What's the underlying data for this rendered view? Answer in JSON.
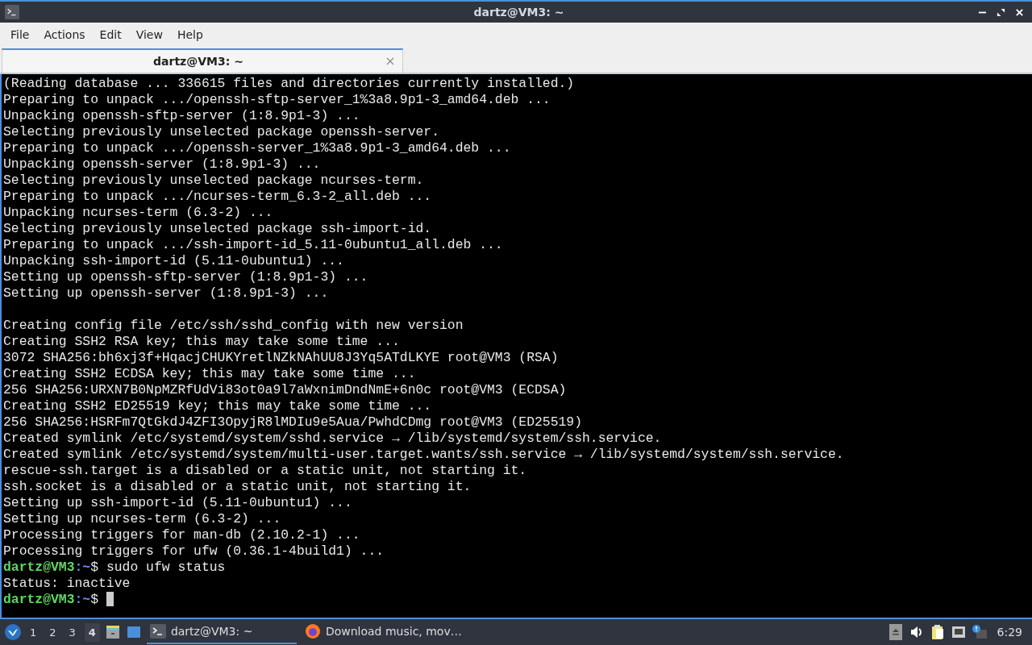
{
  "window": {
    "title": "dartz@VM3: ~"
  },
  "menu": [
    "File",
    "Actions",
    "Edit",
    "View",
    "Help"
  ],
  "tabs": [
    {
      "label": "dartz@VM3: ~",
      "selected": true
    }
  ],
  "terminal": {
    "lines": [
      {
        "kind": "output",
        "text": "(Reading database ... 336615 files and directories currently installed.)"
      },
      {
        "kind": "output",
        "text": "Preparing to unpack .../openssh-sftp-server_1%3a8.9p1-3_amd64.deb ..."
      },
      {
        "kind": "output",
        "text": "Unpacking openssh-sftp-server (1:8.9p1-3) ..."
      },
      {
        "kind": "output",
        "text": "Selecting previously unselected package openssh-server."
      },
      {
        "kind": "output",
        "text": "Preparing to unpack .../openssh-server_1%3a8.9p1-3_amd64.deb ..."
      },
      {
        "kind": "output",
        "text": "Unpacking openssh-server (1:8.9p1-3) ..."
      },
      {
        "kind": "output",
        "text": "Selecting previously unselected package ncurses-term."
      },
      {
        "kind": "output",
        "text": "Preparing to unpack .../ncurses-term_6.3-2_all.deb ..."
      },
      {
        "kind": "output",
        "text": "Unpacking ncurses-term (6.3-2) ..."
      },
      {
        "kind": "output",
        "text": "Selecting previously unselected package ssh-import-id."
      },
      {
        "kind": "output",
        "text": "Preparing to unpack .../ssh-import-id_5.11-0ubuntu1_all.deb ..."
      },
      {
        "kind": "output",
        "text": "Unpacking ssh-import-id (5.11-0ubuntu1) ..."
      },
      {
        "kind": "output",
        "text": "Setting up openssh-sftp-server (1:8.9p1-3) ..."
      },
      {
        "kind": "output",
        "text": "Setting up openssh-server (1:8.9p1-3) ..."
      },
      {
        "kind": "blank"
      },
      {
        "kind": "output",
        "text": "Creating config file /etc/ssh/sshd_config with new version"
      },
      {
        "kind": "output",
        "text": "Creating SSH2 RSA key; this may take some time ..."
      },
      {
        "kind": "output",
        "text": "3072 SHA256:bh6xj3f+HqacjCHUKYretlNZkNAhUU8J3Yq5ATdLKYE root@VM3 (RSA)"
      },
      {
        "kind": "output",
        "text": "Creating SSH2 ECDSA key; this may take some time ..."
      },
      {
        "kind": "output",
        "text": "256 SHA256:URXN7B0NpMZRfUdVi83ot0a9l7aWxnimDndNmE+6n0c root@VM3 (ECDSA)"
      },
      {
        "kind": "output",
        "text": "Creating SSH2 ED25519 key; this may take some time ..."
      },
      {
        "kind": "output",
        "text": "256 SHA256:HSRFm7QtGkdJ4ZFI3OpyjR8lMDIu9e5Aua/PwhdCDmg root@VM3 (ED25519)"
      },
      {
        "kind": "output",
        "text": "Created symlink /etc/systemd/system/sshd.service → /lib/systemd/system/ssh.service."
      },
      {
        "kind": "output",
        "text": "Created symlink /etc/systemd/system/multi-user.target.wants/ssh.service → /lib/systemd/system/ssh.service."
      },
      {
        "kind": "output",
        "text": "rescue-ssh.target is a disabled or a static unit, not starting it."
      },
      {
        "kind": "output",
        "text": "ssh.socket is a disabled or a static unit, not starting it."
      },
      {
        "kind": "output",
        "text": "Setting up ssh-import-id (5.11-0ubuntu1) ..."
      },
      {
        "kind": "output",
        "text": "Setting up ncurses-term (6.3-2) ..."
      },
      {
        "kind": "output",
        "text": "Processing triggers for man-db (2.10.2-1) ..."
      },
      {
        "kind": "output",
        "text": "Processing triggers for ufw (0.36.1-4build1) ..."
      },
      {
        "kind": "prompt",
        "host": "dartz@VM3",
        "path": ":~",
        "symbol": "$",
        "command": "sudo ufw status"
      },
      {
        "kind": "output",
        "text": "Status: inactive"
      },
      {
        "kind": "prompt",
        "host": "dartz@VM3",
        "path": ":~",
        "symbol": "$",
        "cursor": true
      }
    ]
  },
  "taskbar": {
    "workspaces": [
      {
        "label": "1",
        "selected": false
      },
      {
        "label": "2",
        "selected": false
      },
      {
        "label": "3",
        "selected": false
      },
      {
        "label": "4",
        "selected": true
      }
    ],
    "tasks": [
      {
        "kind": "terminal",
        "label": "dartz@VM3: ~",
        "selected": true
      },
      {
        "kind": "browser",
        "label": "Download music, mov…",
        "selected": false
      }
    ],
    "clock": "6:29"
  }
}
